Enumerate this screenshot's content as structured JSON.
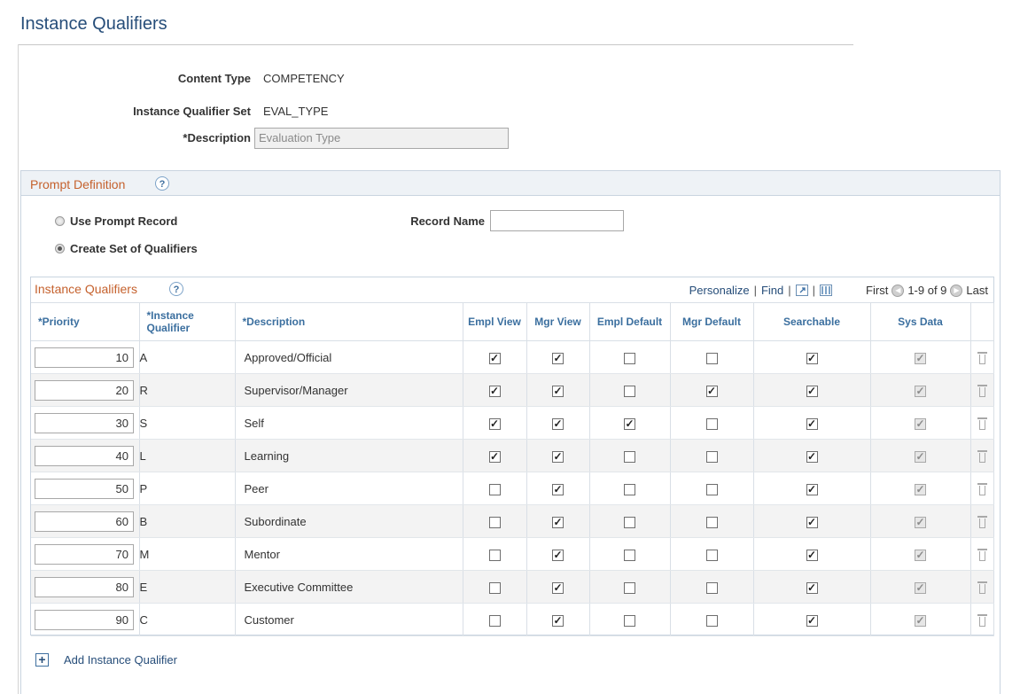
{
  "page": {
    "title": "Instance Qualifiers"
  },
  "fields": {
    "content_type_label": "Content Type",
    "content_type_value": "COMPETENCY",
    "set_label": "Instance Qualifier Set",
    "set_value": "EVAL_TYPE",
    "description_label": "*Description",
    "description_value": "Evaluation Type"
  },
  "prompt": {
    "title": "Prompt Definition",
    "help": "?",
    "radio_prompt_record": "Use Prompt Record",
    "radio_create_set": "Create Set of Qualifiers",
    "selected": "create_set",
    "record_name_label": "Record Name",
    "record_name_value": ""
  },
  "grid": {
    "title": "Instance Qualifiers",
    "help": "?",
    "nav": {
      "personalize": "Personalize",
      "find": "Find",
      "first": "First",
      "range": "1-9 of 9",
      "last": "Last"
    },
    "headers": {
      "priority": "*Priority",
      "qualifier": "*Instance Qualifier",
      "description": "*Description",
      "empl_view": "Empl View",
      "mgr_view": "Mgr View",
      "empl_default": "Empl Default",
      "mgr_default": "Mgr Default",
      "searchable": "Searchable",
      "sys_data": "Sys Data"
    },
    "rows": [
      {
        "priority": "10",
        "qualifier": "A",
        "description": "Approved/Official",
        "empl_view": true,
        "mgr_view": true,
        "empl_default": false,
        "mgr_default": false,
        "searchable": true,
        "sys_data": true
      },
      {
        "priority": "20",
        "qualifier": "R",
        "description": "Supervisor/Manager",
        "empl_view": true,
        "mgr_view": true,
        "empl_default": false,
        "mgr_default": true,
        "searchable": true,
        "sys_data": true
      },
      {
        "priority": "30",
        "qualifier": "S",
        "description": "Self",
        "empl_view": true,
        "mgr_view": true,
        "empl_default": true,
        "mgr_default": false,
        "searchable": true,
        "sys_data": true
      },
      {
        "priority": "40",
        "qualifier": "L",
        "description": "Learning",
        "empl_view": true,
        "mgr_view": true,
        "empl_default": false,
        "mgr_default": false,
        "searchable": true,
        "sys_data": true
      },
      {
        "priority": "50",
        "qualifier": "P",
        "description": "Peer",
        "empl_view": false,
        "mgr_view": true,
        "empl_default": false,
        "mgr_default": false,
        "searchable": true,
        "sys_data": true
      },
      {
        "priority": "60",
        "qualifier": "B",
        "description": "Subordinate",
        "empl_view": false,
        "mgr_view": true,
        "empl_default": false,
        "mgr_default": false,
        "searchable": true,
        "sys_data": true
      },
      {
        "priority": "70",
        "qualifier": "M",
        "description": "Mentor",
        "empl_view": false,
        "mgr_view": true,
        "empl_default": false,
        "mgr_default": false,
        "searchable": true,
        "sys_data": true
      },
      {
        "priority": "80",
        "qualifier": "E",
        "description": "Executive Committee",
        "empl_view": false,
        "mgr_view": true,
        "empl_default": false,
        "mgr_default": false,
        "searchable": true,
        "sys_data": true
      },
      {
        "priority": "90",
        "qualifier": "C",
        "description": "Customer",
        "empl_view": false,
        "mgr_view": true,
        "empl_default": false,
        "mgr_default": false,
        "searchable": true,
        "sys_data": true
      }
    ],
    "add_label": "Add Instance Qualifier"
  },
  "icons": {
    "help": "help-icon",
    "zoom": "zoom-icon",
    "download": "grid-download-icon",
    "prev": "previous-arrow-icon",
    "next": "next-arrow-icon",
    "delete": "trash-icon",
    "add": "add-icon"
  },
  "colors": {
    "title": "#264d79",
    "section_title": "#c5612d",
    "header_text": "#3b6f9f",
    "section_bg": "#eef2f6"
  }
}
